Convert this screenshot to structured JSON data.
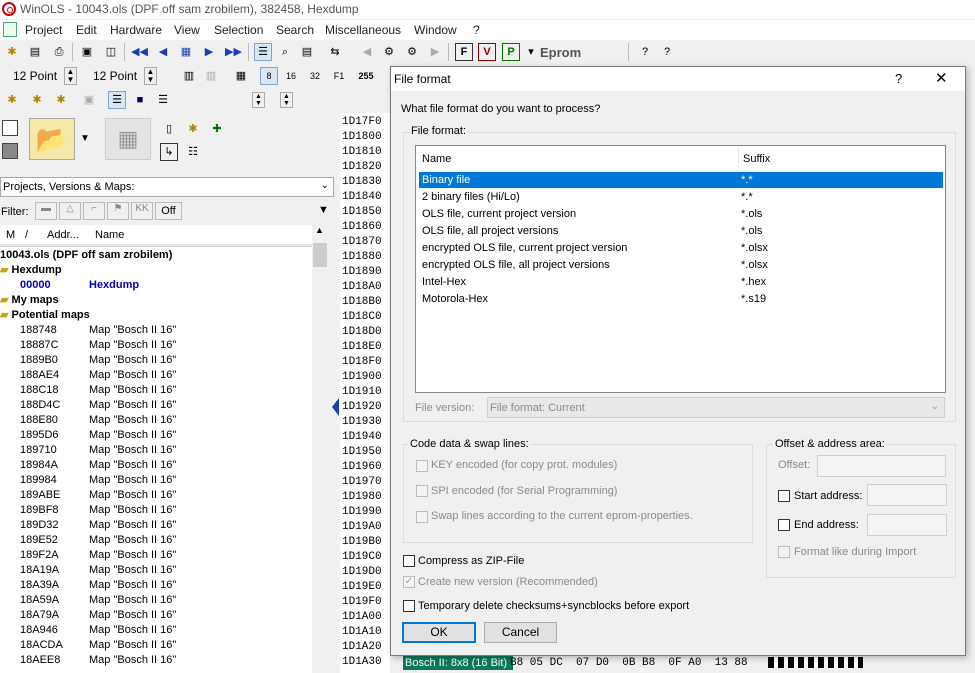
{
  "window": {
    "title": "WinOLS - 10043.ols (DPF off sam zrobilem), 382458, Hexdump"
  },
  "menu": [
    "Project",
    "Edit",
    "Hardware",
    "View",
    "Selection",
    "Search",
    "Miscellaneous",
    "Window",
    "?"
  ],
  "toolbar": {
    "font_size_1": "12 Point",
    "font_size_2": "12 Point",
    "eprom_label": "Eprom",
    "bits": [
      "8",
      "16",
      "32",
      "F1"
    ],
    "num_255": "255"
  },
  "left": {
    "dropdown": "Projects, Versions & Maps:",
    "filter_label": "Filter:",
    "filter_off": "Off",
    "columns": {
      "m": "M",
      "slash": "/",
      "addr": "Addr...",
      "name": "Name"
    },
    "tree_root": "10043.ols (DPF off sam zrobilem)",
    "hexdump_folder": "Hexdump",
    "hexdump_addr": "00000",
    "hexdump_name": "Hexdump",
    "mymaps": "My maps",
    "potential": "Potential maps",
    "maps": [
      {
        "addr": "188748",
        "name": "Map \"Bosch II 16\""
      },
      {
        "addr": "18887C",
        "name": "Map \"Bosch II 16\""
      },
      {
        "addr": "1889B0",
        "name": "Map \"Bosch II 16\""
      },
      {
        "addr": "188AE4",
        "name": "Map \"Bosch II 16\""
      },
      {
        "addr": "188C18",
        "name": "Map \"Bosch II 16\""
      },
      {
        "addr": "188D4C",
        "name": "Map \"Bosch II 16\""
      },
      {
        "addr": "188E80",
        "name": "Map \"Bosch II 16\""
      },
      {
        "addr": "1895D6",
        "name": "Map \"Bosch II 16\""
      },
      {
        "addr": "189710",
        "name": "Map \"Bosch II 16\""
      },
      {
        "addr": "18984A",
        "name": "Map \"Bosch II 16\""
      },
      {
        "addr": "189984",
        "name": "Map \"Bosch II 16\""
      },
      {
        "addr": "189ABE",
        "name": "Map \"Bosch II 16\""
      },
      {
        "addr": "189BF8",
        "name": "Map \"Bosch II 16\""
      },
      {
        "addr": "189D32",
        "name": "Map \"Bosch II 16\""
      },
      {
        "addr": "189E52",
        "name": "Map \"Bosch II 16\""
      },
      {
        "addr": "189F2A",
        "name": "Map \"Bosch II 16\""
      },
      {
        "addr": "18A19A",
        "name": "Map \"Bosch II 16\""
      },
      {
        "addr": "18A39A",
        "name": "Map \"Bosch II 16\""
      },
      {
        "addr": "18A59A",
        "name": "Map \"Bosch II 16\""
      },
      {
        "addr": "18A79A",
        "name": "Map \"Bosch II 16\""
      },
      {
        "addr": "18A946",
        "name": "Map \"Bosch II 16\""
      },
      {
        "addr": "18ACDA",
        "name": "Map \"Bosch II 16\""
      },
      {
        "addr": "18AEE8",
        "name": "Map \"Bosch II 16\""
      }
    ]
  },
  "hex_addresses": [
    "1D17F0",
    "1D1800",
    "1D1810",
    "1D1820",
    "1D1830",
    "1D1840",
    "1D1850",
    "1D1860",
    "1D1870",
    "1D1880",
    "1D1890",
    "1D18A0",
    "1D18B0",
    "1D18C0",
    "1D18D0",
    "1D18E0",
    "1D18F0",
    "1D1900",
    "1D1910",
    "1D1920",
    "1D1930",
    "1D1940",
    "1D1950",
    "1D1960",
    "1D1970",
    "1D1980",
    "1D1990",
    "1D19A0",
    "1D19B0",
    "1D19C0",
    "1D19D0",
    "1D19E0",
    "1D19F0",
    "1D1A00",
    "1D1A10",
    "1D1A20",
    "1D1A30"
  ],
  "hex_bottom": {
    "label": "Bosch II: 8x8 (16 Bit)",
    "bytes": "B8 05 DC  07 D0  0B B8  0F A0  13 88"
  },
  "dialog": {
    "title": "File format",
    "help": "?",
    "close": "✕",
    "question": "What file format do you want to process?",
    "file_format_group": "File format:",
    "col_name": "Name",
    "col_suffix": "Suffix",
    "formats": [
      {
        "name": "Binary file",
        "suffix": "*.*"
      },
      {
        "name": "2 binary files (Hi/Lo)",
        "suffix": "*.*"
      },
      {
        "name": "OLS file, current project version",
        "suffix": "*.ols"
      },
      {
        "name": "OLS file, all project versions",
        "suffix": "*.ols"
      },
      {
        "name": "encrypted OLS file, current project version",
        "suffix": "*.olsx"
      },
      {
        "name": "encrypted OLS file, all project versions",
        "suffix": "*.olsx"
      },
      {
        "name": "Intel-Hex",
        "suffix": "*.hex"
      },
      {
        "name": "Motorola-Hex",
        "suffix": "*.s19"
      }
    ],
    "file_version_label": "File version:",
    "file_version_value": "File format: Current",
    "code_group": "Code data & swap lines:",
    "key_encoded": "KEY encoded (for copy prot. modules)",
    "spi_encoded": "SPI encoded (for Serial Programming)",
    "swap_lines": "Swap lines according to the current eprom-properties.",
    "offset_group": "Offset & address area:",
    "offset_label": "Offset:",
    "start_address": "Start address:",
    "end_address": "End address:",
    "format_like_import": "Format like during Import",
    "compress_zip": "Compress as ZIP-File",
    "create_version": "Create new version (Recommended)",
    "temp_delete": "Temporary delete checksums+syncblocks before export",
    "ok": "OK",
    "cancel": "Cancel"
  },
  "colors": {
    "selection": "#0078d7",
    "link_blue": "#0000c0",
    "hex_green": "#0a7a5a"
  }
}
